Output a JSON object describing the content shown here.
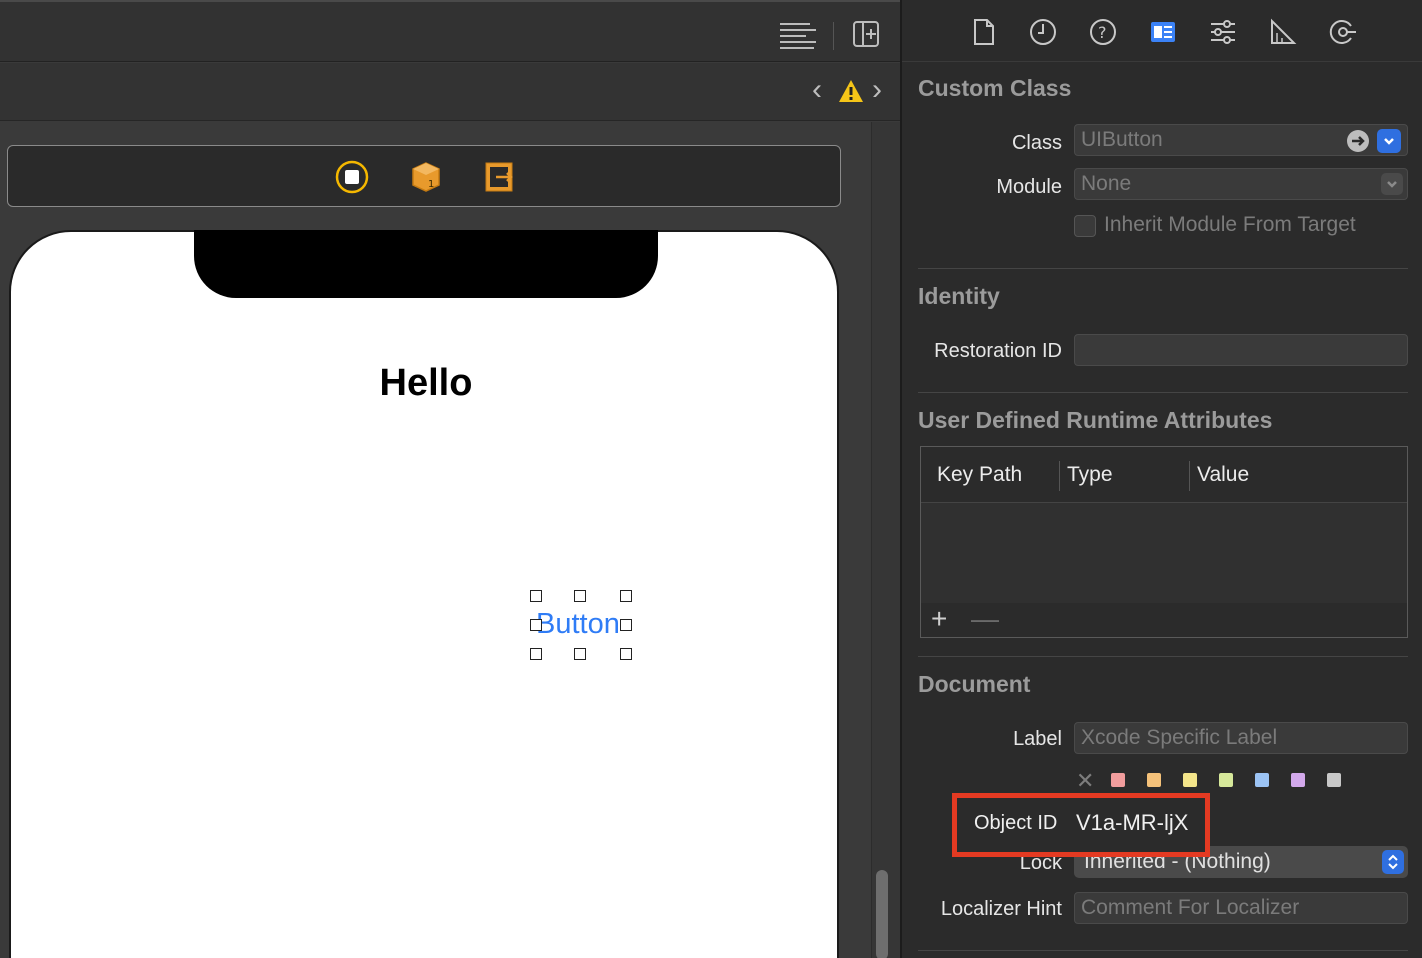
{
  "canvas": {
    "hello_text": "Hello",
    "button_text": "Button"
  },
  "inspector": {
    "custom_class": {
      "title": "Custom Class",
      "class_label": "Class",
      "class_placeholder": "UIButton",
      "module_label": "Module",
      "module_placeholder": "None",
      "inherit_label": "Inherit Module From Target"
    },
    "identity": {
      "title": "Identity",
      "restoration_label": "Restoration ID"
    },
    "runtime_attrs": {
      "title": "User Defined Runtime Attributes",
      "columns": [
        "Key Path",
        "Type",
        "Value"
      ],
      "add": "+",
      "remove": "—"
    },
    "document": {
      "title": "Document",
      "label_label": "Label",
      "label_placeholder": "Xcode Specific Label",
      "clear_mark": "✕",
      "object_id_label": "Object ID",
      "object_id_value": "V1a-MR-ljX",
      "lock_label": "Lock",
      "lock_value": "Inherited - (Nothing)",
      "localizer_label": "Localizer Hint",
      "localizer_placeholder": "Comment For Localizer"
    },
    "label_colors": [
      "#f29d9d",
      "#f5c27a",
      "#f3e58a",
      "#d6e89a",
      "#9cc4f5",
      "#d3a9ec",
      "#c8c8c8"
    ]
  },
  "jump_bar": {
    "back": "‹",
    "warning": "⚠",
    "forward": "›"
  },
  "colors": {
    "accent": "#2f6fe0",
    "highlight_box": "#e43a22",
    "link_blue": "#2f7cf6"
  }
}
